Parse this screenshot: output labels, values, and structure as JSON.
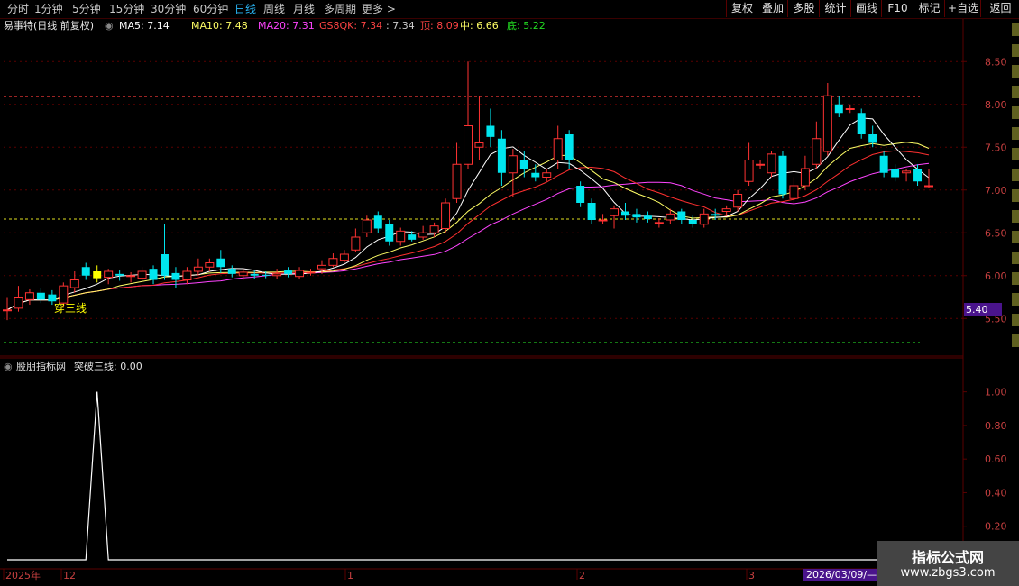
{
  "toolbar": {
    "periods": [
      "分时",
      "1分钟",
      "5分钟",
      "15分钟",
      "30分钟",
      "60分钟",
      "日线",
      "周线",
      "月线",
      "多周期",
      "更多 >"
    ],
    "selected_period": "日线",
    "right_buttons": [
      "复权",
      "叠加",
      "多股",
      "统计",
      "画线",
      "F10",
      "标记",
      "+自选",
      "返回"
    ]
  },
  "main_header": {
    "title": "易事特(日线 前复权)",
    "ma5": "MA5: 7.14",
    "ma10": "MA10: 7.48",
    "ma20": "MA20: 7.31",
    "gs8qk": "GS8QK: 7.34",
    "gs8qk2": ": 7.34",
    "top": "顶: 8.09",
    "mid": "中: 6.66",
    "bottom": "底: 5.22"
  },
  "price_axis": {
    "ticks": [
      "8.50",
      "8.00",
      "7.50",
      "7.00",
      "6.50",
      "6.00",
      "5.50"
    ],
    "current_tag": "5.40"
  },
  "signal_label": "穿三线",
  "indicator_header": {
    "name": "股朋指标网",
    "line": "突破三线: 0.00"
  },
  "indicator_axis": {
    "ticks": [
      "1.00",
      "0.80",
      "0.60",
      "0.40",
      "0.20"
    ]
  },
  "time_axis": {
    "labels": [
      "2025年",
      "12",
      "1",
      "2",
      "3"
    ],
    "cursor_date": "2026/03/09/—"
  },
  "watermark": {
    "line1": "指标公式网",
    "line2": "www.zbgs3.com"
  },
  "colors": {
    "up": "#ff3232",
    "down": "#00e5ee",
    "ma5": "#ffffff",
    "ma10": "#ffff66",
    "ma20": "#ff44ff",
    "gs8qk": "#ff3030",
    "grid": "#5a0000",
    "signal_bar": "#ffff00"
  },
  "chart_data": {
    "type": "candlestick",
    "candles": [
      [
        5.6,
        5.6,
        5.75,
        5.48
      ],
      [
        5.62,
        5.75,
        5.88,
        5.58
      ],
      [
        5.72,
        5.8,
        5.84,
        5.66
      ],
      [
        5.8,
        5.72,
        5.85,
        5.68
      ],
      [
        5.78,
        5.7,
        5.83,
        5.66
      ],
      [
        5.68,
        5.88,
        5.92,
        5.64
      ],
      [
        5.86,
        5.95,
        6.05,
        5.8
      ],
      [
        6.1,
        6.0,
        6.15,
        5.95
      ],
      [
        6.05,
        5.97,
        6.12,
        5.92
      ],
      [
        5.98,
        6.05,
        6.08,
        5.9
      ],
      [
        6.02,
        6.0,
        6.06,
        5.94
      ],
      [
        6.0,
        6.0,
        6.04,
        5.92
      ],
      [
        5.97,
        6.05,
        6.1,
        5.93
      ],
      [
        6.08,
        5.95,
        6.12,
        5.9
      ],
      [
        6.25,
        6.0,
        6.6,
        5.95
      ],
      [
        6.03,
        5.95,
        6.1,
        5.85
      ],
      [
        5.95,
        6.05,
        6.1,
        5.9
      ],
      [
        6.05,
        6.1,
        6.2,
        6.0
      ],
      [
        6.1,
        6.15,
        6.2,
        6.05
      ],
      [
        6.2,
        6.1,
        6.3,
        6.03
      ],
      [
        6.08,
        6.02,
        6.12,
        5.98
      ],
      [
        6.0,
        6.04,
        6.08,
        5.95
      ],
      [
        6.02,
        6.0,
        6.06,
        5.96
      ],
      [
        6.01,
        6.0,
        6.05,
        5.97
      ],
      [
        6.0,
        6.02,
        6.08,
        5.96
      ],
      [
        6.06,
        6.02,
        6.1,
        5.98
      ],
      [
        5.99,
        6.06,
        6.1,
        5.96
      ],
      [
        6.04,
        6.04,
        6.08,
        6.0
      ],
      [
        6.08,
        6.12,
        6.18,
        6.02
      ],
      [
        6.12,
        6.2,
        6.26,
        6.1
      ],
      [
        6.18,
        6.25,
        6.3,
        6.15
      ],
      [
        6.3,
        6.45,
        6.55,
        6.28
      ],
      [
        6.5,
        6.65,
        6.7,
        6.45
      ],
      [
        6.7,
        6.55,
        6.75,
        6.5
      ],
      [
        6.6,
        6.4,
        6.65,
        6.35
      ],
      [
        6.4,
        6.52,
        6.56,
        6.35
      ],
      [
        6.48,
        6.42,
        6.52,
        6.4
      ],
      [
        6.45,
        6.5,
        6.58,
        6.42
      ],
      [
        6.5,
        6.58,
        6.62,
        6.45
      ],
      [
        6.55,
        6.85,
        6.9,
        6.5
      ],
      [
        6.9,
        7.3,
        7.55,
        6.85
      ],
      [
        7.3,
        7.75,
        8.5,
        7.25
      ],
      [
        7.5,
        7.55,
        8.1,
        7.35
      ],
      [
        7.75,
        7.62,
        7.95,
        7.5
      ],
      [
        7.6,
        7.2,
        7.7,
        7.05
      ],
      [
        7.2,
        7.4,
        7.48,
        6.92
      ],
      [
        7.35,
        7.25,
        7.45,
        7.15
      ],
      [
        7.2,
        7.15,
        7.3,
        7.1
      ],
      [
        7.15,
        7.2,
        7.25,
        7.1
      ],
      [
        7.35,
        7.6,
        7.75,
        7.25
      ],
      [
        7.65,
        7.35,
        7.7,
        7.25
      ],
      [
        7.05,
        6.85,
        7.1,
        6.8
      ],
      [
        6.85,
        6.65,
        6.9,
        6.6
      ],
      [
        6.65,
        6.65,
        6.72,
        6.6
      ],
      [
        6.7,
        6.78,
        6.82,
        6.55
      ],
      [
        6.75,
        6.7,
        6.85,
        6.65
      ],
      [
        6.72,
        6.68,
        6.78,
        6.62
      ],
      [
        6.7,
        6.66,
        6.75,
        6.62
      ],
      [
        6.62,
        6.62,
        6.67,
        6.56
      ],
      [
        6.65,
        6.72,
        6.78,
        6.6
      ],
      [
        6.75,
        6.65,
        6.78,
        6.6
      ],
      [
        6.65,
        6.6,
        6.7,
        6.56
      ],
      [
        6.6,
        6.72,
        6.78,
        6.56
      ],
      [
        6.72,
        6.7,
        6.78,
        6.65
      ],
      [
        6.75,
        6.78,
        6.82,
        6.7
      ],
      [
        6.8,
        6.95,
        7.0,
        6.75
      ],
      [
        7.1,
        7.35,
        7.55,
        7.05
      ],
      [
        7.3,
        7.3,
        7.35,
        7.25
      ],
      [
        7.2,
        7.42,
        7.45,
        7.15
      ],
      [
        7.4,
        6.95,
        7.45,
        6.9
      ],
      [
        6.9,
        7.05,
        7.15,
        6.85
      ],
      [
        7.05,
        7.25,
        7.4,
        7.0
      ],
      [
        7.3,
        7.6,
        7.8,
        7.25
      ],
      [
        7.45,
        8.1,
        8.25,
        7.4
      ],
      [
        8.0,
        7.9,
        8.1,
        7.85
      ],
      [
        7.95,
        7.95,
        8.0,
        7.9
      ],
      [
        7.9,
        7.65,
        7.95,
        7.6
      ],
      [
        7.65,
        7.55,
        7.75,
        7.5
      ],
      [
        7.4,
        7.2,
        7.45,
        7.15
      ],
      [
        7.25,
        7.15,
        7.3,
        7.1
      ],
      [
        7.2,
        7.22,
        7.25,
        7.1
      ],
      [
        7.25,
        7.1,
        7.3,
        7.05
      ],
      [
        7.05,
        7.05,
        7.25,
        7.02
      ]
    ],
    "signal_index": 8,
    "indicator": {
      "name": "突破三线",
      "values": [
        0,
        0,
        0,
        0,
        0,
        0,
        0,
        0,
        1,
        0,
        0,
        0,
        0,
        0,
        0,
        0,
        0,
        0,
        0,
        0,
        0,
        0,
        0,
        0,
        0,
        0,
        0,
        0,
        0,
        0,
        0,
        0,
        0,
        0,
        0,
        0,
        0,
        0,
        0,
        0,
        0,
        0,
        0,
        0,
        0,
        0,
        0,
        0,
        0,
        0,
        0,
        0,
        0,
        0,
        0,
        0,
        0,
        0,
        0,
        0,
        0,
        0,
        0,
        0,
        0,
        0,
        0,
        0,
        0,
        0,
        0,
        0,
        0,
        0,
        0,
        0,
        0,
        0,
        0,
        0,
        0,
        0,
        0
      ]
    },
    "levels": {
      "top": 8.09,
      "mid": 6.66,
      "bottom": 5.22
    },
    "ylim": [
      5.05,
      8.85
    ],
    "indicator_ylim": [
      0,
      1.1
    ]
  }
}
